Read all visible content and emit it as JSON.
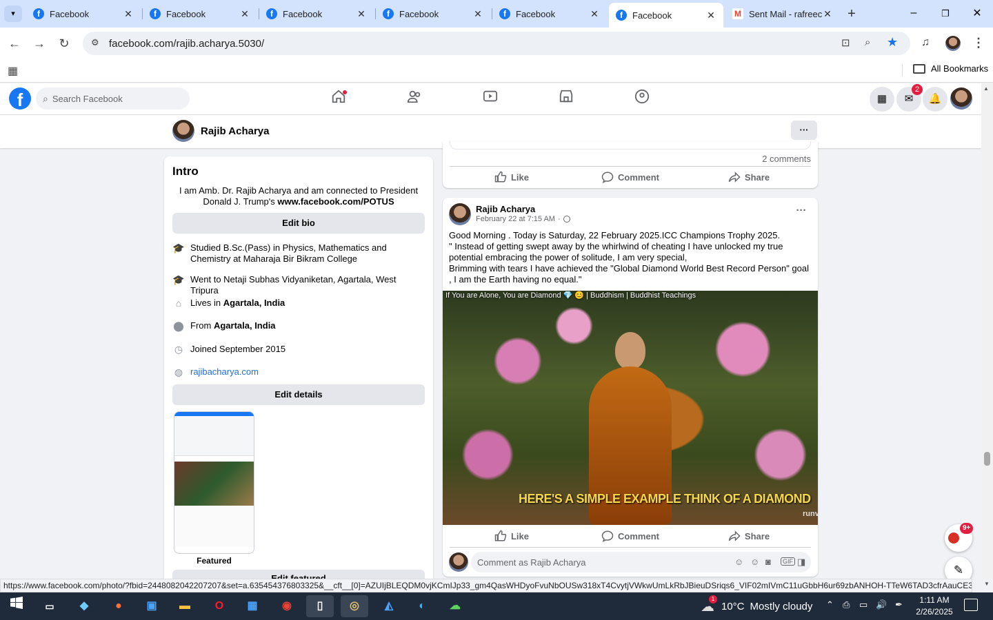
{
  "browser": {
    "tabs": [
      {
        "title": "Facebook",
        "icon": "facebook-icon"
      },
      {
        "title": "Facebook",
        "icon": "facebook-icon"
      },
      {
        "title": "Facebook",
        "icon": "facebook-icon"
      },
      {
        "title": "Facebook",
        "icon": "facebook-icon"
      },
      {
        "title": "Facebook",
        "icon": "facebook-icon"
      },
      {
        "title": "Facebook",
        "icon": "facebook-icon",
        "active": true
      },
      {
        "title": "Sent Mail - rafreec",
        "icon": "gmail-icon"
      }
    ],
    "url": "facebook.com/rajib.acharya.5030/",
    "all_bookmarks": "All Bookmarks",
    "status_url": "https://www.facebook.com/photo/?fbid=2448082042207207&set=a.635454376803325&__cft__[0]=AZUIjBLEQDM0vjKCmIJp33_gm4QasWHDyoFvuNbOUSw318xT4CvytjVWkwUmLkRbJBieuDSriqs6_VIF02mIVmC11uGbbH6ur69zbANHOH-TTeW6TAD3cfrAauCE3vprr..."
  },
  "facebook": {
    "search_placeholder": "Search Facebook",
    "messenger_badge": "2",
    "profile_name": "Rajib Acharya",
    "more_label": "···"
  },
  "intro": {
    "title": "Intro",
    "bio_text": "I am Amb. Dr. Rajib Acharya and am connected to President Donald J. Trump's ",
    "bio_link": "www.facebook.com/POTUS",
    "edit_bio": "Edit bio",
    "details": [
      {
        "icon": "graduation-cap-icon",
        "text": "Studied B.Sc.(Pass) in Physics, Mathematics and Chemistry at Maharaja Bir Bikram College"
      },
      {
        "icon": "graduation-cap-icon",
        "text": "Went to Netaji Subhas Vidyaniketan, Agartala, West Tripura"
      },
      {
        "icon": "home-icon",
        "prefix": "Lives in ",
        "bold": "Agartala, India"
      },
      {
        "icon": "location-pin-icon",
        "prefix": "From ",
        "bold": "Agartala, India"
      },
      {
        "icon": "clock-icon",
        "text": "Joined September 2015"
      },
      {
        "icon": "globe-icon",
        "link": "rajibacharya.com"
      }
    ],
    "edit_details": "Edit details",
    "featured_label": "Featured",
    "edit_featured": "Edit featured"
  },
  "prev_post": {
    "comments_count": "2 comments",
    "like": "Like",
    "comment": "Comment",
    "share": "Share"
  },
  "post": {
    "author": "Rajib Acharya",
    "time": "February 22 at 7:15 AM",
    "dot": "·",
    "lines": [
      "Good Morning . Today is Saturday, 22 February 2025.ICC Champions Trophy 2025.",
      "\" Instead of getting swept away by the whirlwind of cheating I  have unlocked my true potential embracing the power of solitude, I am very special,",
      "Brimming with tears I have achieved the \"Global Diamond World Best Record Person\" goal ,  I am the Earth having no equal.\""
    ],
    "video_title": "If You are Alone, You are Diamond 💎 😊 | Buddhism | Buddhist Teachings",
    "video_caption": "HERE'S A SIMPLE EXAMPLE THINK OF A DIAMOND",
    "watermark": "runv",
    "like": "Like",
    "comment": "Comment",
    "share": "Share",
    "comment_placeholder": "Comment as Rajib Acharya"
  },
  "news_badge": "9+",
  "taskbar": {
    "weather_temp": "10°C",
    "weather_text": "Mostly cloudy",
    "weather_badge": "1",
    "time": "1:11 AM",
    "date": "2/26/2025"
  },
  "colors": {
    "fb_blue": "#1877f2",
    "tab_strip": "#d3e3fd",
    "taskbar": "#1f2a3a"
  }
}
